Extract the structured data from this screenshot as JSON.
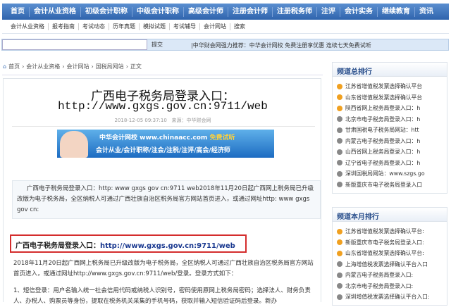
{
  "nav": [
    "首页",
    "会计从业资格",
    "初级会计职称",
    "中级会计职称",
    "高级会计师",
    "注册会计师",
    "注册税务师",
    "注评",
    "会计实务",
    "继续教育",
    "资讯"
  ],
  "subnav": [
    "会计从业资格",
    "报考指南",
    "考试动态",
    "历年真题",
    "模拟试题",
    "考试辅导",
    "会计网站",
    "搜索"
  ],
  "search": {
    "value": "",
    "button": "提交",
    "promo": "|中华财会网强力推荐：中华会计网校 免费注册享优惠 连续七天免费试听"
  },
  "breadcrumb": [
    "首页",
    "会计从业资格",
    "会计网站",
    "国税局网站",
    "正文"
  ],
  "article": {
    "title1": "广西电子税务局登录入口：",
    "title2": "http://www.gxgs.gov.cn:9711/web",
    "date": "2018-12-05 09:37:10",
    "source": "来源：中华财会网",
    "banner_line1": "中华会计网校 www.chinaacc.com",
    "banner_free": "免费试听",
    "banner_line2": "会计从业/会计职称/注会/注税/注评/高会/经济师",
    "summary": "广西电子税务局登录入口：http: www gxgs gov cn:9711 web2018年11月20日起广西网上税务局已升级改版为电子税务局，全区纳税人可通过广西壮族自治区税务局官方网站首页进入，或通过网址http: www gxgs gov cn:",
    "highlight_label": "广西电子税务局登录入口：",
    "highlight_link": "http://www.gxgs.gov.cn:9711/web",
    "para1": "2018年11月20日起广西网上税务局已升级改版为电子税务局，全区纳税人可通过广西壮族自治区税务局官方网站首页进入，或通过网址http://www.gxgs.gov.cn:9711/web/登录。登录方式如下：",
    "para2": "1、短信登录：用户名输入统一社会信用代码或纳税人识别号，密码使用原网上税务局密码；选择法人、财务负责人、办税人、购票员等身份，提取在税务机关采集的手机号码，获取并输入短信验证码后登录。新办"
  },
  "sidebar": [
    {
      "title": "频道总排行",
      "items": [
        "江苏省增值税发票选择确认平台",
        "山东省增值税发票选择确认平台",
        "陕西省网上税务局登录入口：h",
        "北京市电子税务局登录入口：h",
        "甘肃国税电子税务局网站：htt",
        "内蒙古电子税务局登录入口：h",
        "山西省网上税务局登录入口：h",
        "辽宁省电子税务局登录入口：h",
        "深圳国税局网站：www.szgs.go",
        "新版重庆市电子税务局登录入口"
      ]
    },
    {
      "title": "频道本月排行",
      "items": [
        "江苏省增值税发票选择确认平台:",
        "新版重庆市电子税务局登录入口:",
        "山东省增值税发票选择确认平台:",
        "上海增值税发票选择确认平台入口",
        "内蒙古电子税务局登录入口:",
        "北京市电子税务局登录入口:",
        "深圳增值税发票选择确认平台入口:"
      ]
    }
  ],
  "colors": {
    "nav": "#2f64ad",
    "accent": "#d42d2d",
    "link": "#1a3990"
  }
}
